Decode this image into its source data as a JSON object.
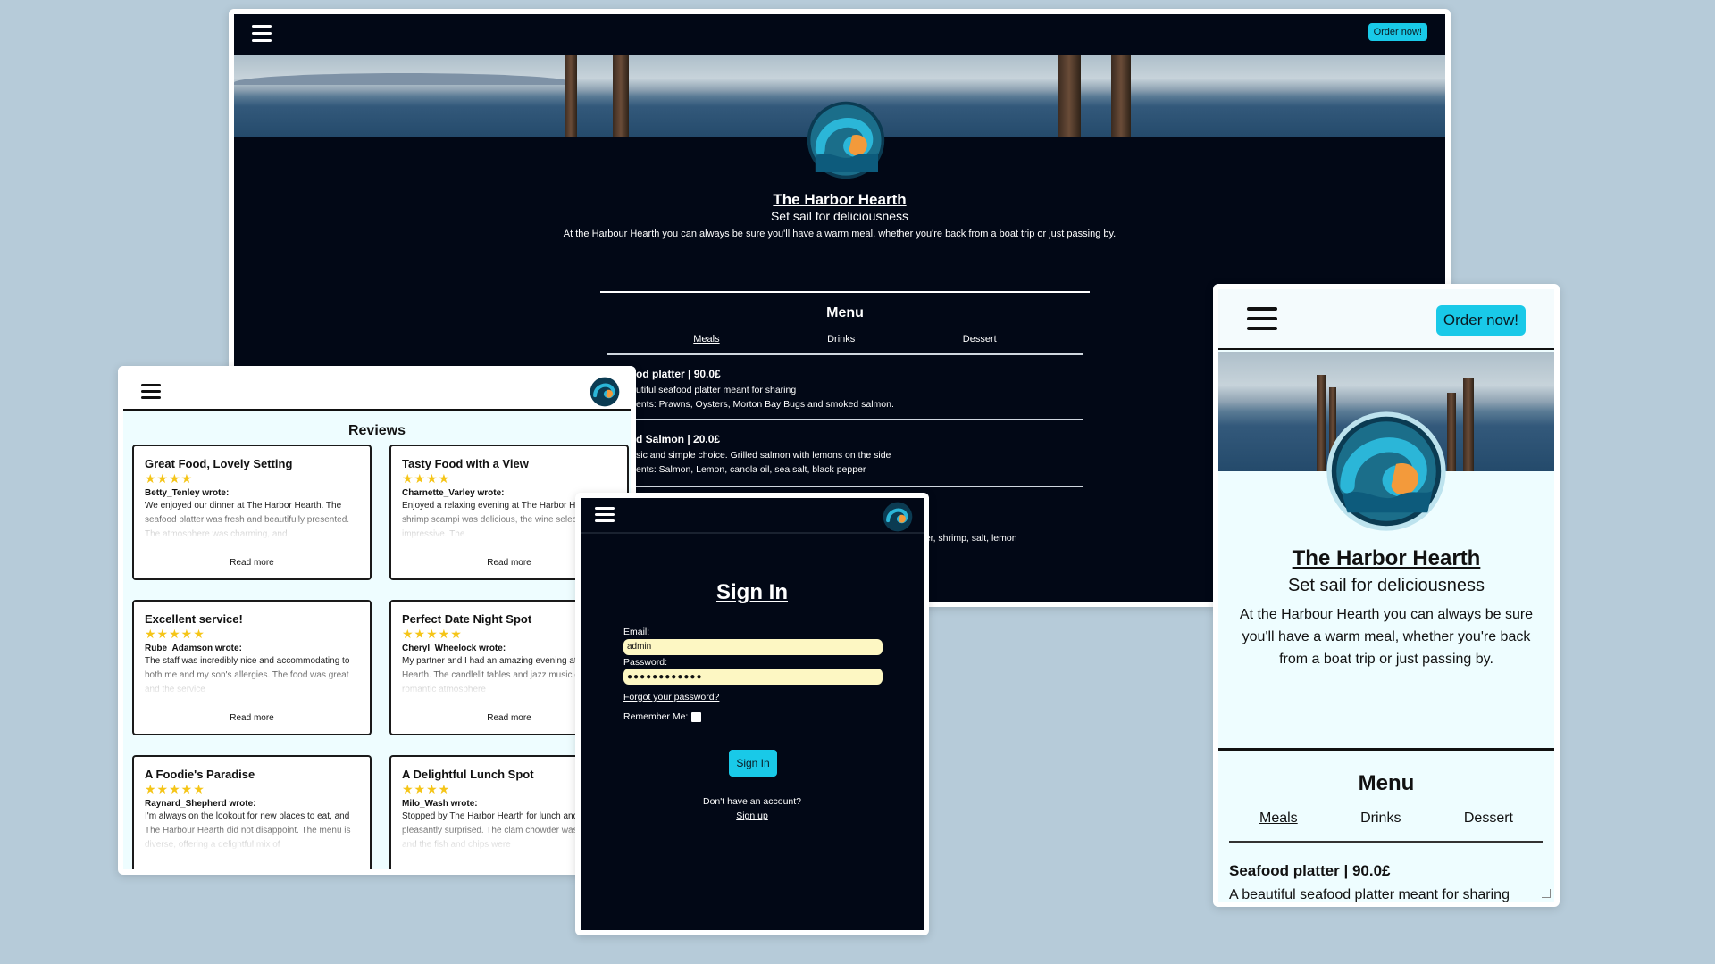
{
  "brand": {
    "name": "The Harbor Hearth",
    "tagline": "Set sail for deliciousness",
    "description": "At the Harbour Hearth you can always be sure you'll have a warm meal, whether you're back from a boat trip or just passing by.",
    "accent": "#19c9e8"
  },
  "desktop": {
    "order_button": "Order now!",
    "menu_title": "Menu",
    "tabs": [
      "Meals",
      "Drinks",
      "Dessert"
    ],
    "items": [
      {
        "title": "od platter | 90.0£",
        "line1": "utiful seafood platter meant for sharing",
        "line2": "ents: Prawns, Oysters, Morton Bay Bugs and smoked salmon."
      },
      {
        "title": "d Salmon | 20.0£",
        "line1": "sic and simple choice. Grilled salmon with lemons on the side",
        "line2": "ents: Salmon, Lemon, canola oil, sea salt, black pepper"
      }
    ],
    "peek_text": "per, shrimp, salt, lemon"
  },
  "reviews": {
    "title": "Reviews",
    "read_more": "Read more",
    "cards": [
      {
        "title": "Great Food, Lovely Setting",
        "stars": "★★★★",
        "author": "Betty_Tenley wrote:",
        "body": "We enjoyed our dinner at The Harbor Hearth. The seafood platter was fresh and beautifully presented. The atmosphere was charming, and"
      },
      {
        "title": "Tasty Food with a View",
        "stars": "★★★★",
        "author": "Charnette_Varley wrote:",
        "body": "Enjoyed a relaxing evening at The Harbor Hearth. The shrimp scampi was delicious, the wine selection was impressive. The"
      },
      {
        "title": "Excellent service!",
        "stars": "★★★★★",
        "author": "Rube_Adamson wrote:",
        "body": "The staff was incredibly nice and accommodating to both me and my son's allergies. The food was great and the service"
      },
      {
        "title": "Perfect Date Night Spot",
        "stars": "★★★★★",
        "author": "Cheryl_Wheelock wrote:",
        "body": "My partner and I had an amazing evening at Harbour Hearth. The candlelit tables and jazz music created a romantic atmosphere"
      },
      {
        "title": "A Foodie's Paradise",
        "stars": "★★★★★",
        "author": "Raynard_Shepherd wrote:",
        "body": "I'm always on the lookout for new places to eat, and The Harbour Hearth did not disappoint. The menu is diverse, offering a delightful mix of"
      },
      {
        "title": "A Delightful Lunch Spot",
        "stars": "★★★★",
        "author": "Milo_Wash wrote:",
        "body": "Stopped by The Harbor Hearth for lunch and was pleasantly surprised. The clam chowder was hearty, and the fish and chips were"
      }
    ]
  },
  "signin": {
    "title": "Sign In",
    "email_label": "Email:",
    "email_value": "admin",
    "password_label": "Password:",
    "password_value": "●●●●●●●●●●●●",
    "forgot": "Forgot your password?",
    "remember": "Remember Me:",
    "button": "Sign In",
    "no_account": "Don't have an account?",
    "signup": "Sign up"
  },
  "mobile": {
    "order_button": "Order now!",
    "menu_title": "Menu",
    "tabs": [
      "Meals",
      "Drinks",
      "Dessert"
    ],
    "item_title": "Seafood platter | 90.0£",
    "item_line1": "A beautiful seafood platter meant for sharing"
  }
}
